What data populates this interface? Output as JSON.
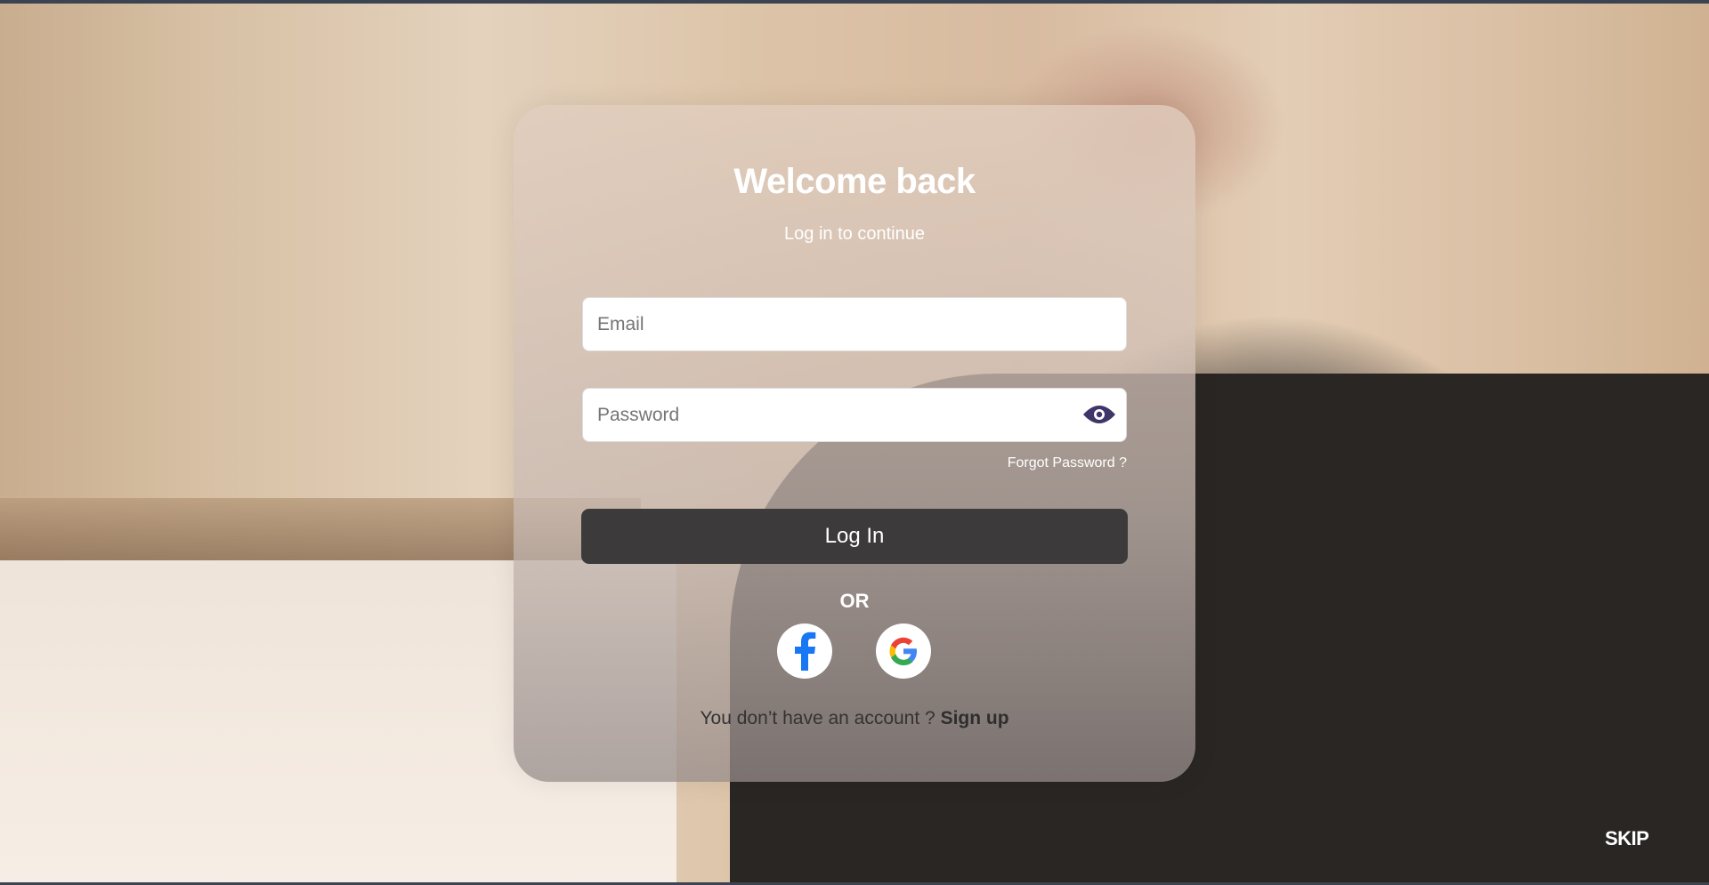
{
  "login": {
    "title": "Welcome back",
    "subtitle": "Log in to continue",
    "email_placeholder": "Email",
    "password_placeholder": "Password",
    "forgot_password": "Forgot Password ?",
    "login_button": "Log In",
    "or_label": "OR",
    "signup_prompt": "You don’t have an account ?",
    "signup_link": "Sign up"
  },
  "social": [
    {
      "name": "facebook-icon",
      "color": "#1877f2"
    },
    {
      "name": "google-icon",
      "color": "#4285f4"
    }
  ],
  "skip_label": "SKIP",
  "colors": {
    "button": "#3c3a3b",
    "eye_icon": "#3f3568"
  }
}
